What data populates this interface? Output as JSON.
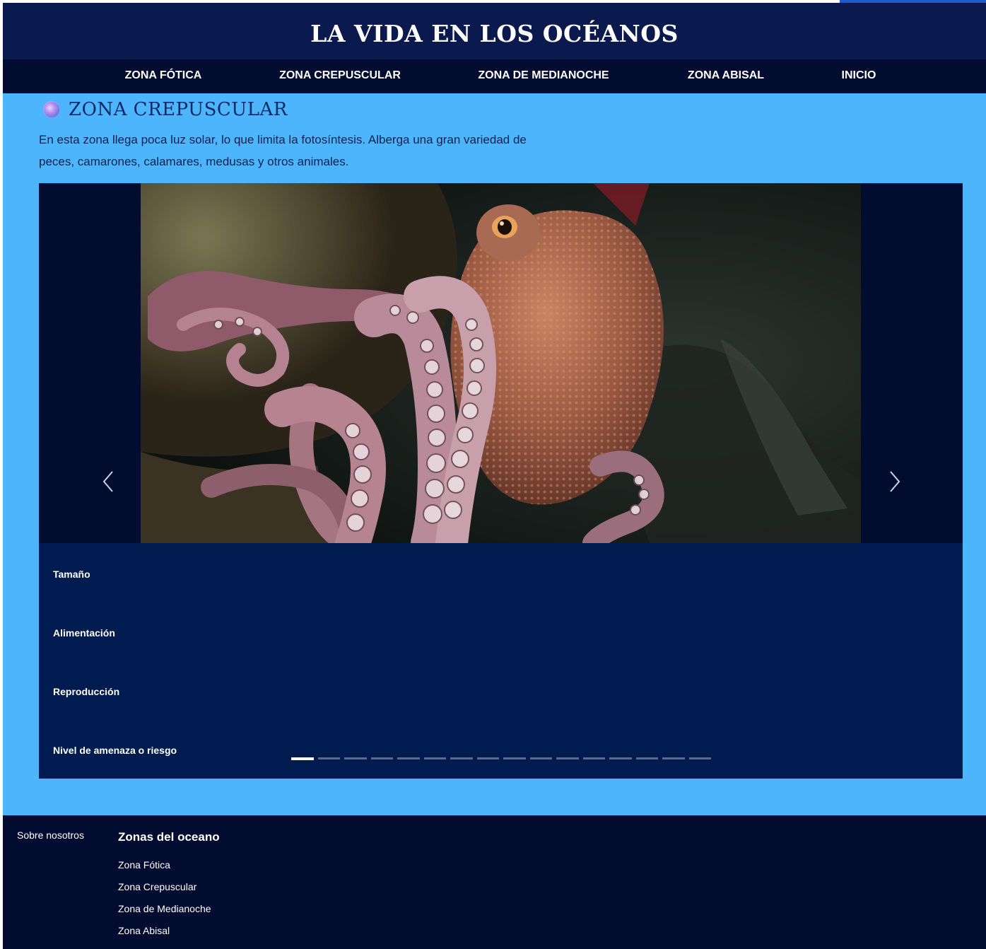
{
  "header": {
    "title": "LA VIDA EN LOS OCÉANOS"
  },
  "nav": {
    "items": [
      {
        "label": "ZONA FÓTICA"
      },
      {
        "label": "ZONA CREPUSCULAR"
      },
      {
        "label": "ZONA DE MEDIANOCHE"
      },
      {
        "label": "ZONA ABISAL"
      },
      {
        "label": "INICIO"
      }
    ]
  },
  "section": {
    "icon": "zone-orb-icon",
    "title": "ZONA CREPUSCULAR",
    "description": "En esta zona llega poca luz solar, lo que limita la fotosíntesis. Alberga una gran variedad de peces, camarones, calamares, medusas y otros animales."
  },
  "carousel": {
    "image_subject": "octopus-photo",
    "prev_icon": "chevron-left-icon",
    "next_icon": "chevron-right-icon",
    "info_labels": [
      "Tamaño",
      "Alimentación",
      "Reproducción",
      "Nivel de amenaza o riesgo"
    ],
    "slide_count": 16,
    "active_slide": 1
  },
  "footer": {
    "about": "Sobre nosotros",
    "zones_heading": "Zonas del oceano",
    "zones_links": [
      "Zona Fótica",
      "Zona Crepuscular",
      "Zona de Medianoche",
      "Zona Abisal"
    ]
  },
  "colors": {
    "header_bg": "#0a1a4f",
    "nav_bg": "#020b30",
    "page_bg": "#4db5fb",
    "carousel_bg": "#001b4f",
    "footer_bg": "#020b30",
    "text_dark": "#0d2150"
  }
}
